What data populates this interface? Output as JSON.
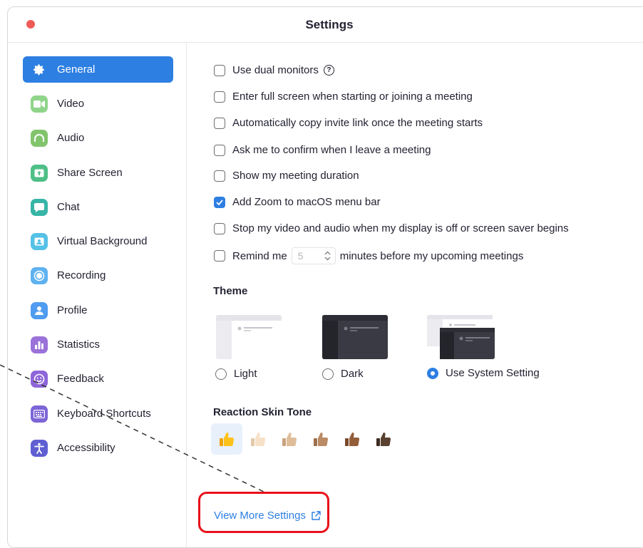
{
  "window": {
    "title": "Settings"
  },
  "sidebar": {
    "items": [
      {
        "label": "General",
        "icon": "gear-icon",
        "color": "#2d7fe2",
        "active": true
      },
      {
        "label": "Video",
        "icon": "video-camera-icon",
        "color": "#8fd48a"
      },
      {
        "label": "Audio",
        "icon": "headphones-icon",
        "color": "#82c46c"
      },
      {
        "label": "Share Screen",
        "icon": "share-screen-icon",
        "color": "#4fbf87"
      },
      {
        "label": "Chat",
        "icon": "chat-bubble-icon",
        "color": "#38b5a6"
      },
      {
        "label": "Virtual Background",
        "icon": "person-frame-icon",
        "color": "#55c1e6"
      },
      {
        "label": "Recording",
        "icon": "record-icon",
        "color": "#5fb2f0"
      },
      {
        "label": "Profile",
        "icon": "profile-icon",
        "color": "#4f9cf0"
      },
      {
        "label": "Statistics",
        "icon": "bar-chart-icon",
        "color": "#9a72d9"
      },
      {
        "label": "Feedback",
        "icon": "smiley-icon",
        "color": "#8e65d8"
      },
      {
        "label": "Keyboard Shortcuts",
        "icon": "keyboard-icon",
        "color": "#7c65d6"
      },
      {
        "label": "Accessibility",
        "icon": "accessibility-icon",
        "color": "#5f5fd2"
      }
    ]
  },
  "options": [
    {
      "label": "Use dual monitors",
      "checked": false,
      "help": "?"
    },
    {
      "label": "Enter full screen when starting or joining a meeting",
      "checked": false
    },
    {
      "label": "Automatically copy invite link once the meeting starts",
      "checked": false
    },
    {
      "label": "Ask me to confirm when I leave a meeting",
      "checked": false
    },
    {
      "label": "Show my meeting duration",
      "checked": false
    },
    {
      "label": "Add Zoom to macOS menu bar",
      "checked": true
    },
    {
      "label": "Stop my video and audio when my display is off or screen saver begins",
      "checked": false
    },
    {
      "label_before": "Remind me",
      "stepper_value": "5",
      "label_after": "minutes before my upcoming meetings",
      "checked": false
    }
  ],
  "theme": {
    "title": "Theme",
    "options": [
      {
        "label": "Light",
        "selected": false
      },
      {
        "label": "Dark",
        "selected": false
      },
      {
        "label": "Use System Setting",
        "selected": true
      }
    ]
  },
  "skin_tone": {
    "title": "Reaction Skin Tone",
    "tones": [
      "👍",
      "👍🏻",
      "👍🏼",
      "👍🏽",
      "👍🏾",
      "👍🏿"
    ],
    "selected": 0
  },
  "more_link": {
    "label": "View More Settings",
    "icon": "external-link-icon"
  },
  "colors": {
    "accent": "#2d7fe2",
    "highlight": "#e8101b",
    "close_button": "#ee5b57"
  }
}
